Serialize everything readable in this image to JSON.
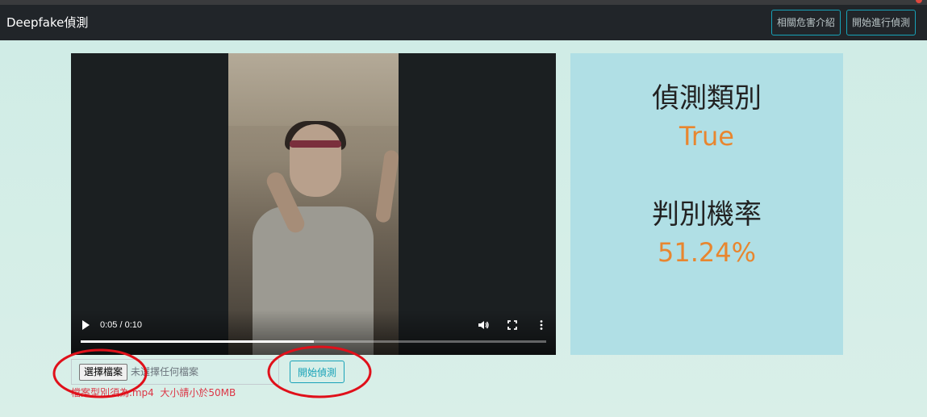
{
  "navbar": {
    "brand": "Deepfake偵測",
    "buttons": [
      {
        "label": "相關危害介紹"
      },
      {
        "label": "開始進行偵測"
      }
    ]
  },
  "video": {
    "time": "0:05 / 0:10",
    "progress_fraction": 0.5,
    "icons": [
      "play-icon",
      "volume-icon",
      "fullscreen-icon",
      "more-options-icon"
    ]
  },
  "result": {
    "category_label": "偵測類別",
    "category_value": "True",
    "probability_label": "判別機率",
    "probability_value": "51.24%",
    "value_color": "#e8862f",
    "panel_color": "#b0dfe5"
  },
  "upload": {
    "choose_button": "選擇檔案",
    "no_file_text": "未選擇任何檔案",
    "detect_button": "開始偵測",
    "hint": "檔案型別須為.mp4  大小請小於50MB"
  },
  "colors": {
    "navbar": "#212529",
    "accent": "#17a2b8",
    "annotation": "#e0101a",
    "hint": "#dc3545"
  }
}
